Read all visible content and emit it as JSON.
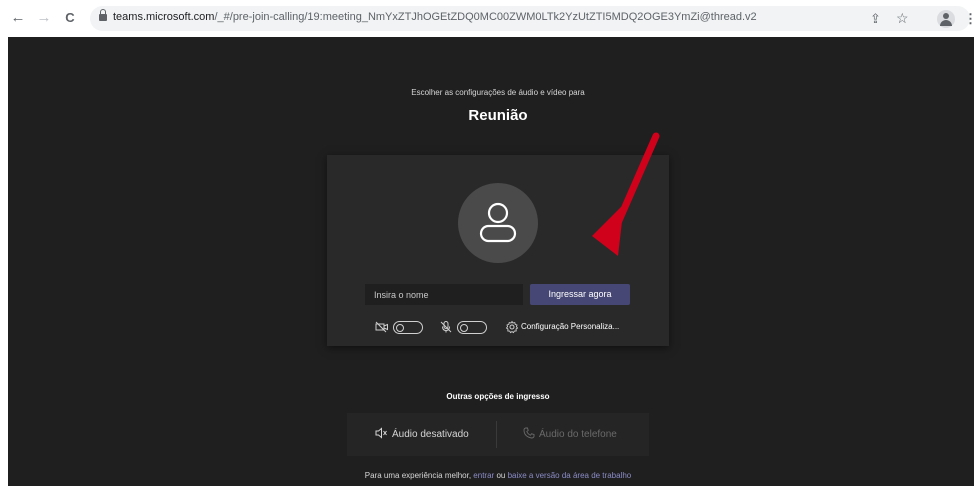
{
  "browser": {
    "back_icon": "←",
    "forward_icon": "→",
    "reload_icon": "C",
    "url_host": "teams.microsoft.com",
    "url_path": "/_#/pre-join-calling/19:meeting_NmYxZTJhOGEtZDQ0MC00ZWM0LTk2YzUtZTI5MDQ2OGE3YmZi@thread.v2",
    "share_icon": "⇪",
    "star_icon": "☆",
    "menu_icon": "⋮"
  },
  "prejoin": {
    "subtitle": "Escolher as configurações de áudio e vídeo para",
    "title": "Reunião",
    "name_placeholder": "Insira o nome",
    "join_label": "Ingressar agora",
    "camera_state": "off",
    "mic_state": "off",
    "custom_settings_label": "Configuração Personaliza..."
  },
  "other_options": {
    "title": "Outras opções de ingresso",
    "audio_off_label": "Áudio desativado",
    "phone_audio_label": "Áudio do telefone"
  },
  "footer": {
    "prefix": "Para uma experiência melhor,",
    "link_signin": "entrar",
    "middle": "ou",
    "link_download": "baixe a versão da área de trabalho"
  },
  "colors": {
    "page_bg": "#1f1f1f",
    "card_bg": "#292929",
    "join_button": "#464775",
    "link": "#8b8cc7",
    "annotation_arrow": "#d0021b"
  }
}
